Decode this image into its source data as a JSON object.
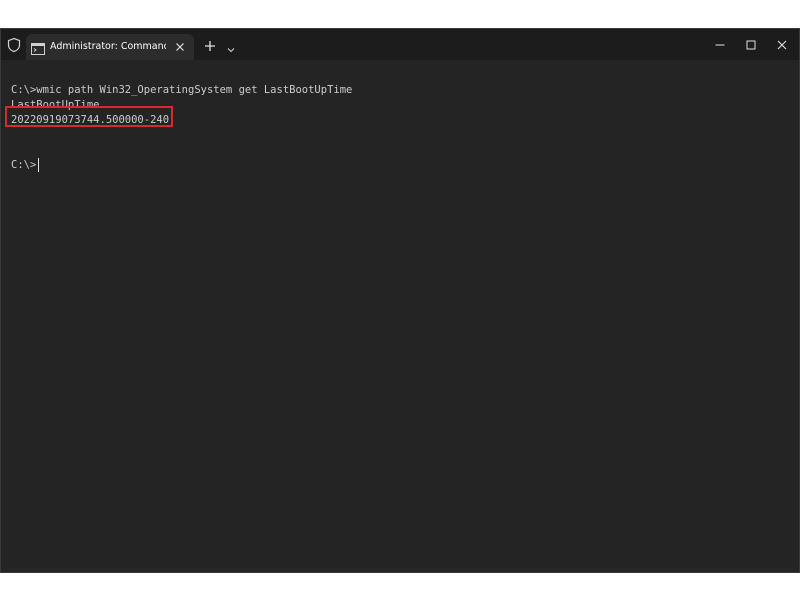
{
  "window": {
    "tab_title": "Administrator: Command Prom",
    "icons": {
      "shield": "shield-icon",
      "terminal": "terminal-icon",
      "close_tab": "close-icon",
      "new_tab": "plus-icon",
      "dropdown": "chevron-down-icon",
      "minimize": "minimize-icon",
      "maximize": "maximize-icon",
      "close_window": "close-icon"
    }
  },
  "console": {
    "lines": [
      "C:\\>wmic path Win32_OperatingSystem get LastBootUpTime",
      "LastBootUpTime",
      "20220919073744.500000-240",
      "C:\\>"
    ]
  },
  "colors": {
    "background": "#242424",
    "titlebar": "#1c1c1c",
    "text": "#cccccc",
    "highlight_border": "#d9282f"
  }
}
